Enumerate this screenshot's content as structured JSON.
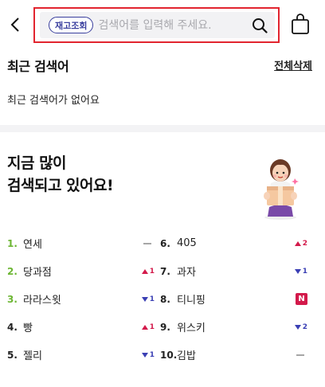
{
  "header": {
    "inventory_badge": "재고조회",
    "search_placeholder": "검색어를 입력해 주세요."
  },
  "recent": {
    "title": "최근 검색어",
    "delete_all": "전체삭제",
    "empty_message": "최근 검색어가 없어요"
  },
  "popular": {
    "title_line1": "지금 많이",
    "title_line2": "검색되고 있어요!",
    "left": [
      {
        "rank": "1.",
        "keyword": "연세",
        "change": "same",
        "delta": ""
      },
      {
        "rank": "2.",
        "keyword": "당과점",
        "change": "up",
        "delta": "1"
      },
      {
        "rank": "3.",
        "keyword": "라라스윗",
        "change": "down",
        "delta": "1"
      },
      {
        "rank": "4.",
        "keyword": "빵",
        "change": "up",
        "delta": "1"
      },
      {
        "rank": "5.",
        "keyword": "젤리",
        "change": "down",
        "delta": "1"
      }
    ],
    "right": [
      {
        "rank": "6.",
        "keyword": "405",
        "change": "up",
        "delta": "2"
      },
      {
        "rank": "7.",
        "keyword": "과자",
        "change": "down",
        "delta": "1"
      },
      {
        "rank": "8.",
        "keyword": "티니핑",
        "change": "new",
        "delta": "N"
      },
      {
        "rank": "9.",
        "keyword": "위스키",
        "change": "down",
        "delta": "2"
      },
      {
        "rank": "10.",
        "keyword": "김밥",
        "change": "same",
        "delta": ""
      }
    ]
  },
  "colors": {
    "highlight_border": "#e2252f",
    "top_rank_green": "#6db634",
    "up_red": "#d31a4b",
    "down_blue": "#3a3fb4",
    "badge_navy": "#3a3f9e"
  },
  "icons": {
    "back": "chevron-left-icon",
    "search": "search-icon",
    "bag": "shopping-bag-icon",
    "character": "box-holding-character-illustration"
  }
}
